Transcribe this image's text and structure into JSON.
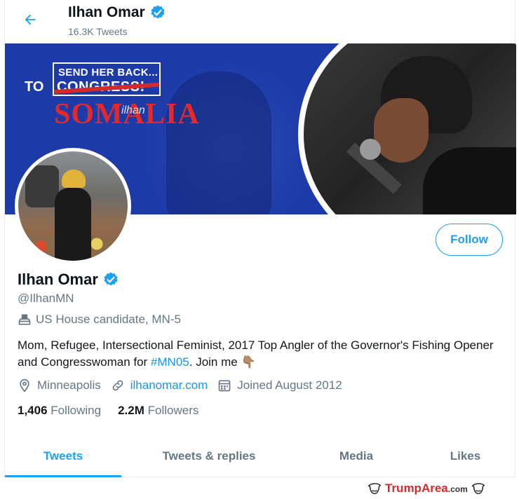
{
  "header": {
    "name": "Ilhan Omar",
    "tweet_count": "16.3K Tweets",
    "back_icon": "arrow-left-icon"
  },
  "banner": {
    "line1": "SEND HER BACK...",
    "to": "TO",
    "congress": "CONGRESS!",
    "somalia": "SOMALIA",
    "signature": "ilhan"
  },
  "profile": {
    "name": "Ilhan Omar",
    "handle": "@IlhanMN",
    "role": "US House candidate, MN-5",
    "bio_part1": "Mom, Refugee, Intersectional Feminist, 2017 Top Angler of the Governor's Fishing Opener and Congresswoman for ",
    "bio_hashtag": "#MN05",
    "bio_part2": ". Join me ",
    "bio_emoji": "👇🏽",
    "location": "Minneapolis",
    "website": "ilhanomar.com",
    "joined": "Joined August 2012",
    "following_count": "1,406",
    "following_label": "Following",
    "followers_count": "2.2M",
    "followers_label": "Followers"
  },
  "follow_button": "Follow",
  "tabs": [
    {
      "label": "Tweets",
      "active": true
    },
    {
      "label": "Tweets & replies",
      "active": false
    },
    {
      "label": "Media",
      "active": false
    },
    {
      "label": "Likes",
      "active": false
    }
  ],
  "watermark": {
    "brand": "TrumpArea",
    "suffix": ".com"
  },
  "colors": {
    "accent": "#1da1f2",
    "banner_blue": "#1c3aa8",
    "slogan_red": "#e52828"
  }
}
